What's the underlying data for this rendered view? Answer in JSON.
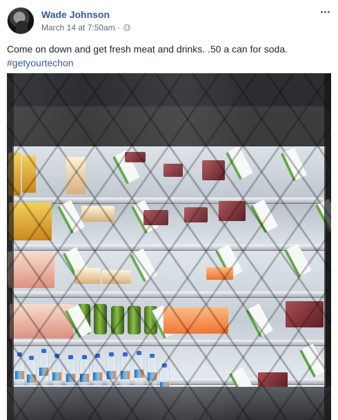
{
  "post": {
    "author_name": "Wade Johnson",
    "timestamp": "March 14 at 7:50am",
    "separator": "·",
    "audience_icon": "globe-icon",
    "more_options_icon": "more-options-icon",
    "text_line_1": "Come on down and get fresh meat and drinks. .50 a can for soda.",
    "hashtag": "#getyourtechon"
  },
  "photo": {
    "subject": "refrigerated-display-case-icon"
  },
  "colors": {
    "link": "#385898",
    "meta": "#616770",
    "divider_green": "#5eaa43"
  }
}
